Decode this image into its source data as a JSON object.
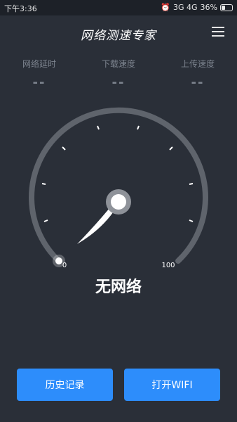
{
  "status_bar": {
    "time": "下午3:36",
    "network": "3G 4G",
    "battery": "36%"
  },
  "header": {
    "title": "网络测速专家"
  },
  "metrics": [
    {
      "label": "网络延时",
      "value": "--"
    },
    {
      "label": "下载速度",
      "value": "--"
    },
    {
      "label": "上传速度",
      "value": "--"
    }
  ],
  "gauge": {
    "min_label": "0",
    "max_label": "100",
    "status": "无网络"
  },
  "buttons": {
    "history": "历史记录",
    "wifi": "打开WIFI"
  },
  "colors": {
    "background": "#2a2f38",
    "status_bar": "#1d2128",
    "button": "#2d8dfb",
    "gauge_track": "#5f646c"
  }
}
